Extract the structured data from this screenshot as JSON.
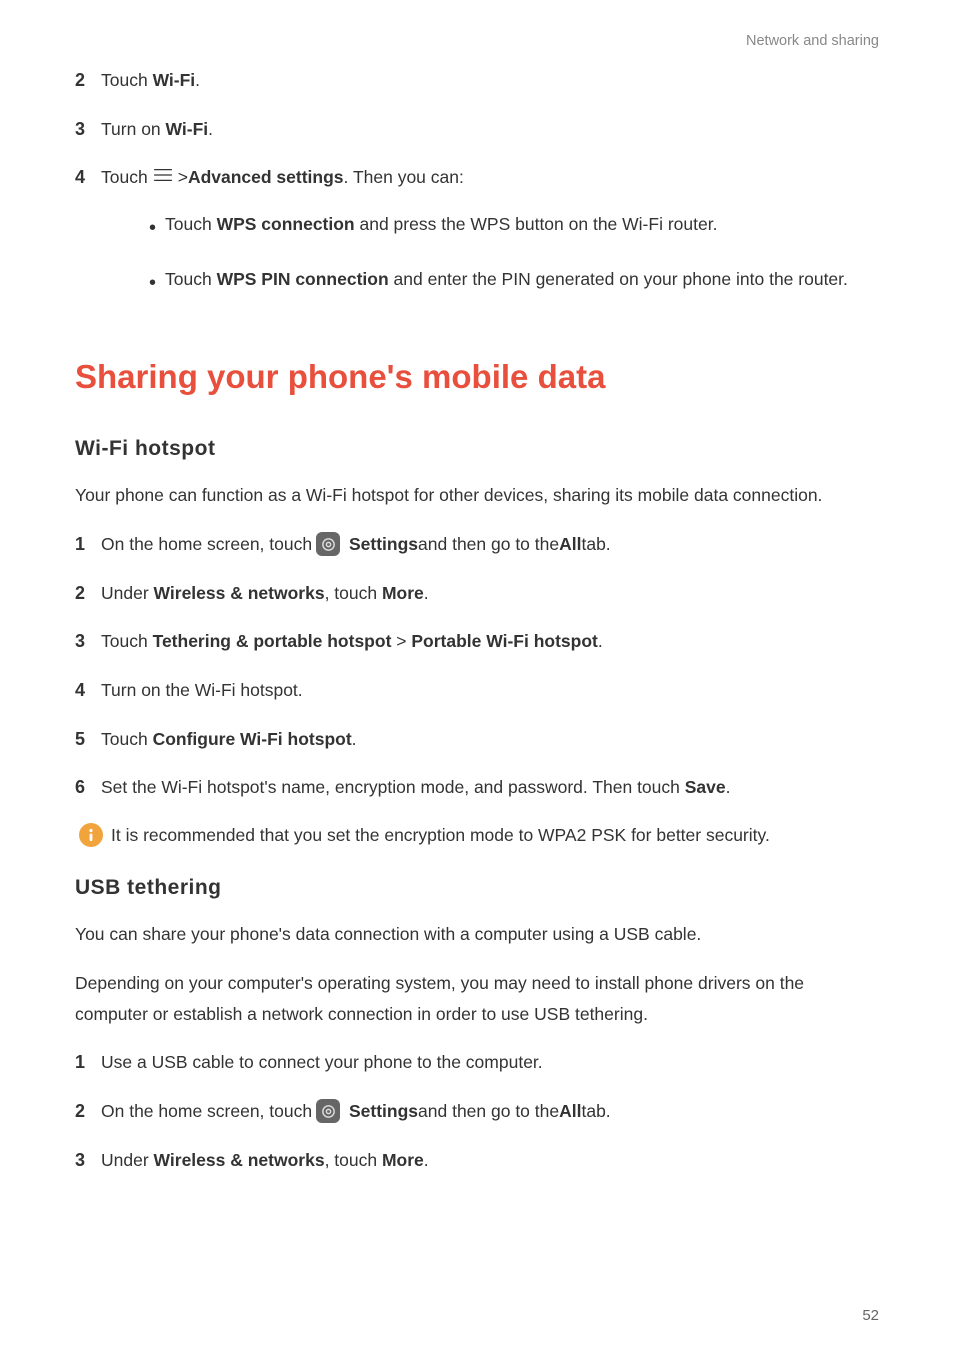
{
  "header": "Network and sharing",
  "stepsA": {
    "s2_pre": "Touch ",
    "s2_b": "Wi-Fi",
    "s2_post": ".",
    "s3_pre": "Turn on ",
    "s3_b": "Wi-Fi",
    "s3_post": ".",
    "s4_pre": "Touch ",
    "s4_gt": "> ",
    "s4_b": "Advanced settings",
    "s4_post": ". Then you can:"
  },
  "bulletsA": {
    "b1_pre": "Touch ",
    "b1_b": "WPS connection",
    "b1_post": " and press the WPS button on the Wi-Fi router.",
    "b2_pre": "Touch ",
    "b2_b": "WPS PIN connection",
    "b2_post": " and enter the PIN generated on your phone into the router."
  },
  "heading1": "Sharing your phone's mobile data",
  "sub1": "Wi-Fi  hotspot",
  "para1": "Your phone can function as a Wi-Fi hotspot for other devices, sharing its mobile data connection.",
  "stepsB": {
    "s1_pre": "On the home screen, touch ",
    "s1_b": "Settings",
    "s1_mid": " and then go to the ",
    "s1_b2": "All",
    "s1_post": " tab.",
    "s2_pre": "Under ",
    "s2_b": "Wireless & networks",
    "s2_mid": ", touch ",
    "s2_b2": "More",
    "s2_post": ".",
    "s3_pre": "Touch ",
    "s3_b": "Tethering & portable hotspot",
    "s3_gt": " > ",
    "s3_b2": "Portable Wi-Fi hotspot",
    "s3_post": ".",
    "s4": "Turn on the Wi-Fi hotspot.",
    "s5_pre": "Touch ",
    "s5_b": "Configure Wi-Fi hotspot",
    "s5_post": ".",
    "s6_pre": "Set the Wi-Fi hotspot's name, encryption mode, and password. Then touch ",
    "s6_b": "Save",
    "s6_post": "."
  },
  "info1": "It is recommended that you set the encryption mode to WPA2 PSK for better security.",
  "sub2": "USB  tethering",
  "para2": "You can share your phone's data connection with a computer using a USB cable.",
  "para3": "Depending on your computer's operating system, you may need to install phone drivers on the computer or establish a network connection in order to use USB tethering.",
  "stepsC": {
    "s1": "Use a USB cable to connect your phone to the computer.",
    "s2_pre": "On the home screen, touch ",
    "s2_b": "Settings",
    "s2_mid": " and then go to the ",
    "s2_b2": "All",
    "s2_post": " tab.",
    "s3_pre": "Under ",
    "s3_b": "Wireless & networks",
    "s3_mid": ", touch ",
    "s3_b2": "More",
    "s3_post": "."
  },
  "pageNum": "52"
}
